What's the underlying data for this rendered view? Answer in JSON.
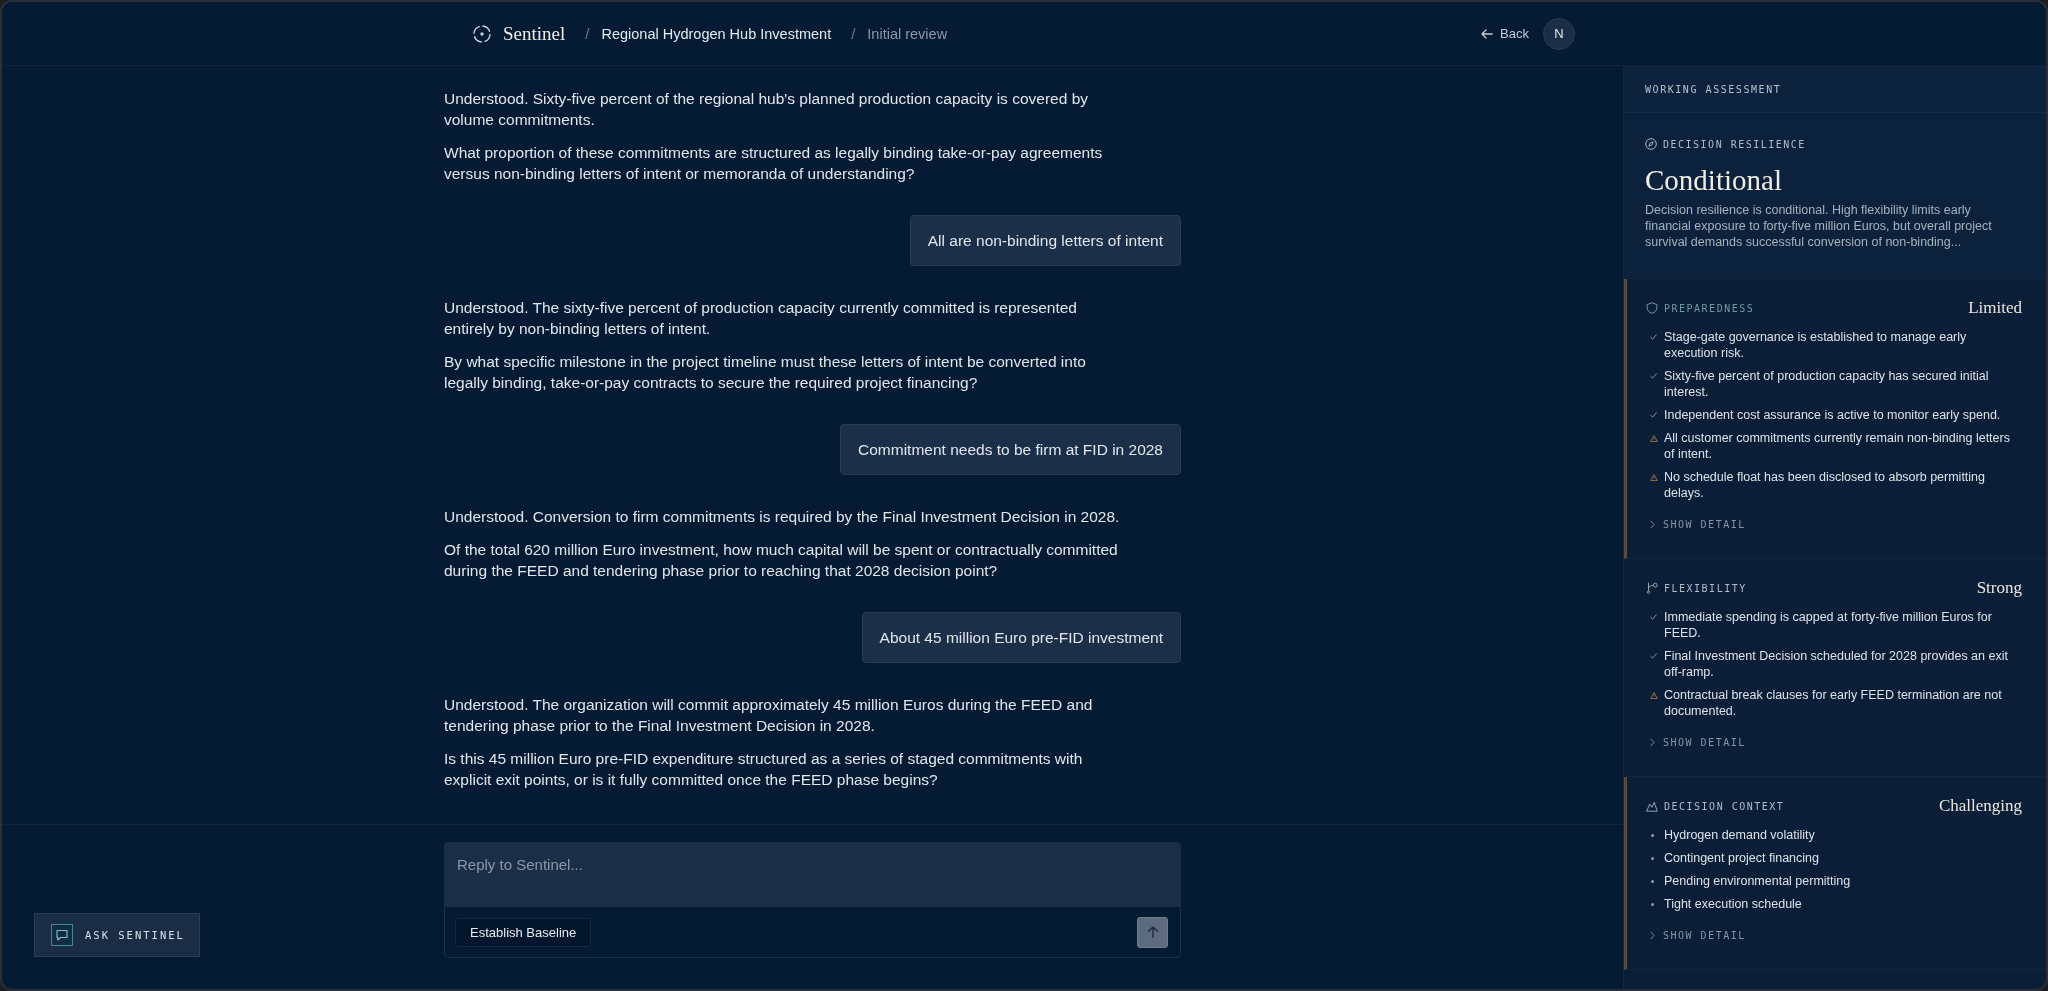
{
  "header": {
    "brand": "Sentinel",
    "breadcrumbs": [
      {
        "separator": "/",
        "label": "Regional Hydrogen Hub Investment",
        "current": false
      },
      {
        "separator": "/",
        "label": "Initial review",
        "current": true
      }
    ],
    "back_label": "Back",
    "avatar_initial": "N"
  },
  "conversation": [
    {
      "kind": "assistant",
      "paragraphs": [
        "Understood. Sixty-five percent of the regional hub's planned production capacity is covered by volume commitments.",
        "What proportion of these commitments are structured as legally binding take-or-pay agreements versus non-binding letters of intent or memoranda of understanding?"
      ]
    },
    {
      "kind": "user",
      "text": "All are non-binding letters of intent"
    },
    {
      "kind": "assistant",
      "paragraphs": [
        "Understood. The sixty-five percent of production capacity currently committed is represented entirely by non-binding letters of intent.",
        "By what specific milestone in the project timeline must these letters of intent be converted into legally binding, take-or-pay contracts to secure the required project financing?"
      ]
    },
    {
      "kind": "user",
      "text": "Commitment needs to be firm at FID in 2028"
    },
    {
      "kind": "assistant",
      "paragraphs": [
        "Understood. Conversion to firm commitments is required by the Final Investment Decision in 2028.",
        "Of the total 620 million Euro investment, how much capital will be spent or contractually committed during the FEED and tendering phase prior to reaching that 2028 decision point?"
      ]
    },
    {
      "kind": "user",
      "text": "About 45 million Euro pre-FID investment"
    },
    {
      "kind": "assistant",
      "paragraphs": [
        "Understood. The organization will commit approximately 45 million Euros during the FEED and tendering phase prior to the Final Investment Decision in 2028.",
        "Is this 45 million Euro pre-FID expenditure structured as a series of staged commitments with explicit exit points, or is it fully committed once the FEED phase begins?"
      ]
    }
  ],
  "composer": {
    "placeholder": "Reply to Sentinel...",
    "chips": [
      "Establish Baseline"
    ],
    "send_disabled": true
  },
  "ask_button": {
    "label": "ASK SENTINEL"
  },
  "assessment": {
    "title": "WORKING ASSESSMENT",
    "resilience": {
      "label": "DECISION RESILIENCE",
      "rating": "Conditional",
      "summary": "Decision resilience is conditional. High flexibility limits early financial exposure to forty-five million Euros, but overall project survival demands successful conversion of non-binding..."
    },
    "sections": [
      {
        "label": "PREPAREDNESS",
        "rating": "Limited",
        "flagged": true,
        "items": [
          {
            "kind": "strength",
            "text": "Stage-gate governance is established to manage early execution risk."
          },
          {
            "kind": "strength",
            "text": "Sixty-five percent of production capacity has secured initial interest."
          },
          {
            "kind": "strength",
            "text": "Independent cost assurance is active to monitor early spend."
          },
          {
            "kind": "risk",
            "text": "All customer commitments currently remain non-binding letters of intent."
          },
          {
            "kind": "risk",
            "text": "No schedule float has been disclosed to absorb permitting delays."
          }
        ],
        "toggle_label": "SHOW DETAIL",
        "expanded": false
      },
      {
        "label": "FLEXIBILITY",
        "rating": "Strong",
        "flagged": false,
        "items": [
          {
            "kind": "strength",
            "text": "Immediate spending is capped at forty-five million Euros for FEED."
          },
          {
            "kind": "strength",
            "text": "Final Investment Decision scheduled for 2028 provides an exit off-ramp."
          },
          {
            "kind": "risk",
            "text": "Contractual break clauses for early FEED termination are not documented."
          }
        ],
        "toggle_label": "SHOW DETAIL",
        "expanded": false
      },
      {
        "label": "DECISION CONTEXT",
        "rating": "Challenging",
        "flagged": true,
        "items": [
          {
            "kind": "factor",
            "text": "Hydrogen demand volatility"
          },
          {
            "kind": "factor",
            "text": "Contingent project financing"
          },
          {
            "kind": "factor",
            "text": "Pending environmental permitting"
          },
          {
            "kind": "factor",
            "text": "Tight execution schedule"
          }
        ],
        "toggle_label": "SHOW DETAIL",
        "expanded": false
      }
    ]
  }
}
